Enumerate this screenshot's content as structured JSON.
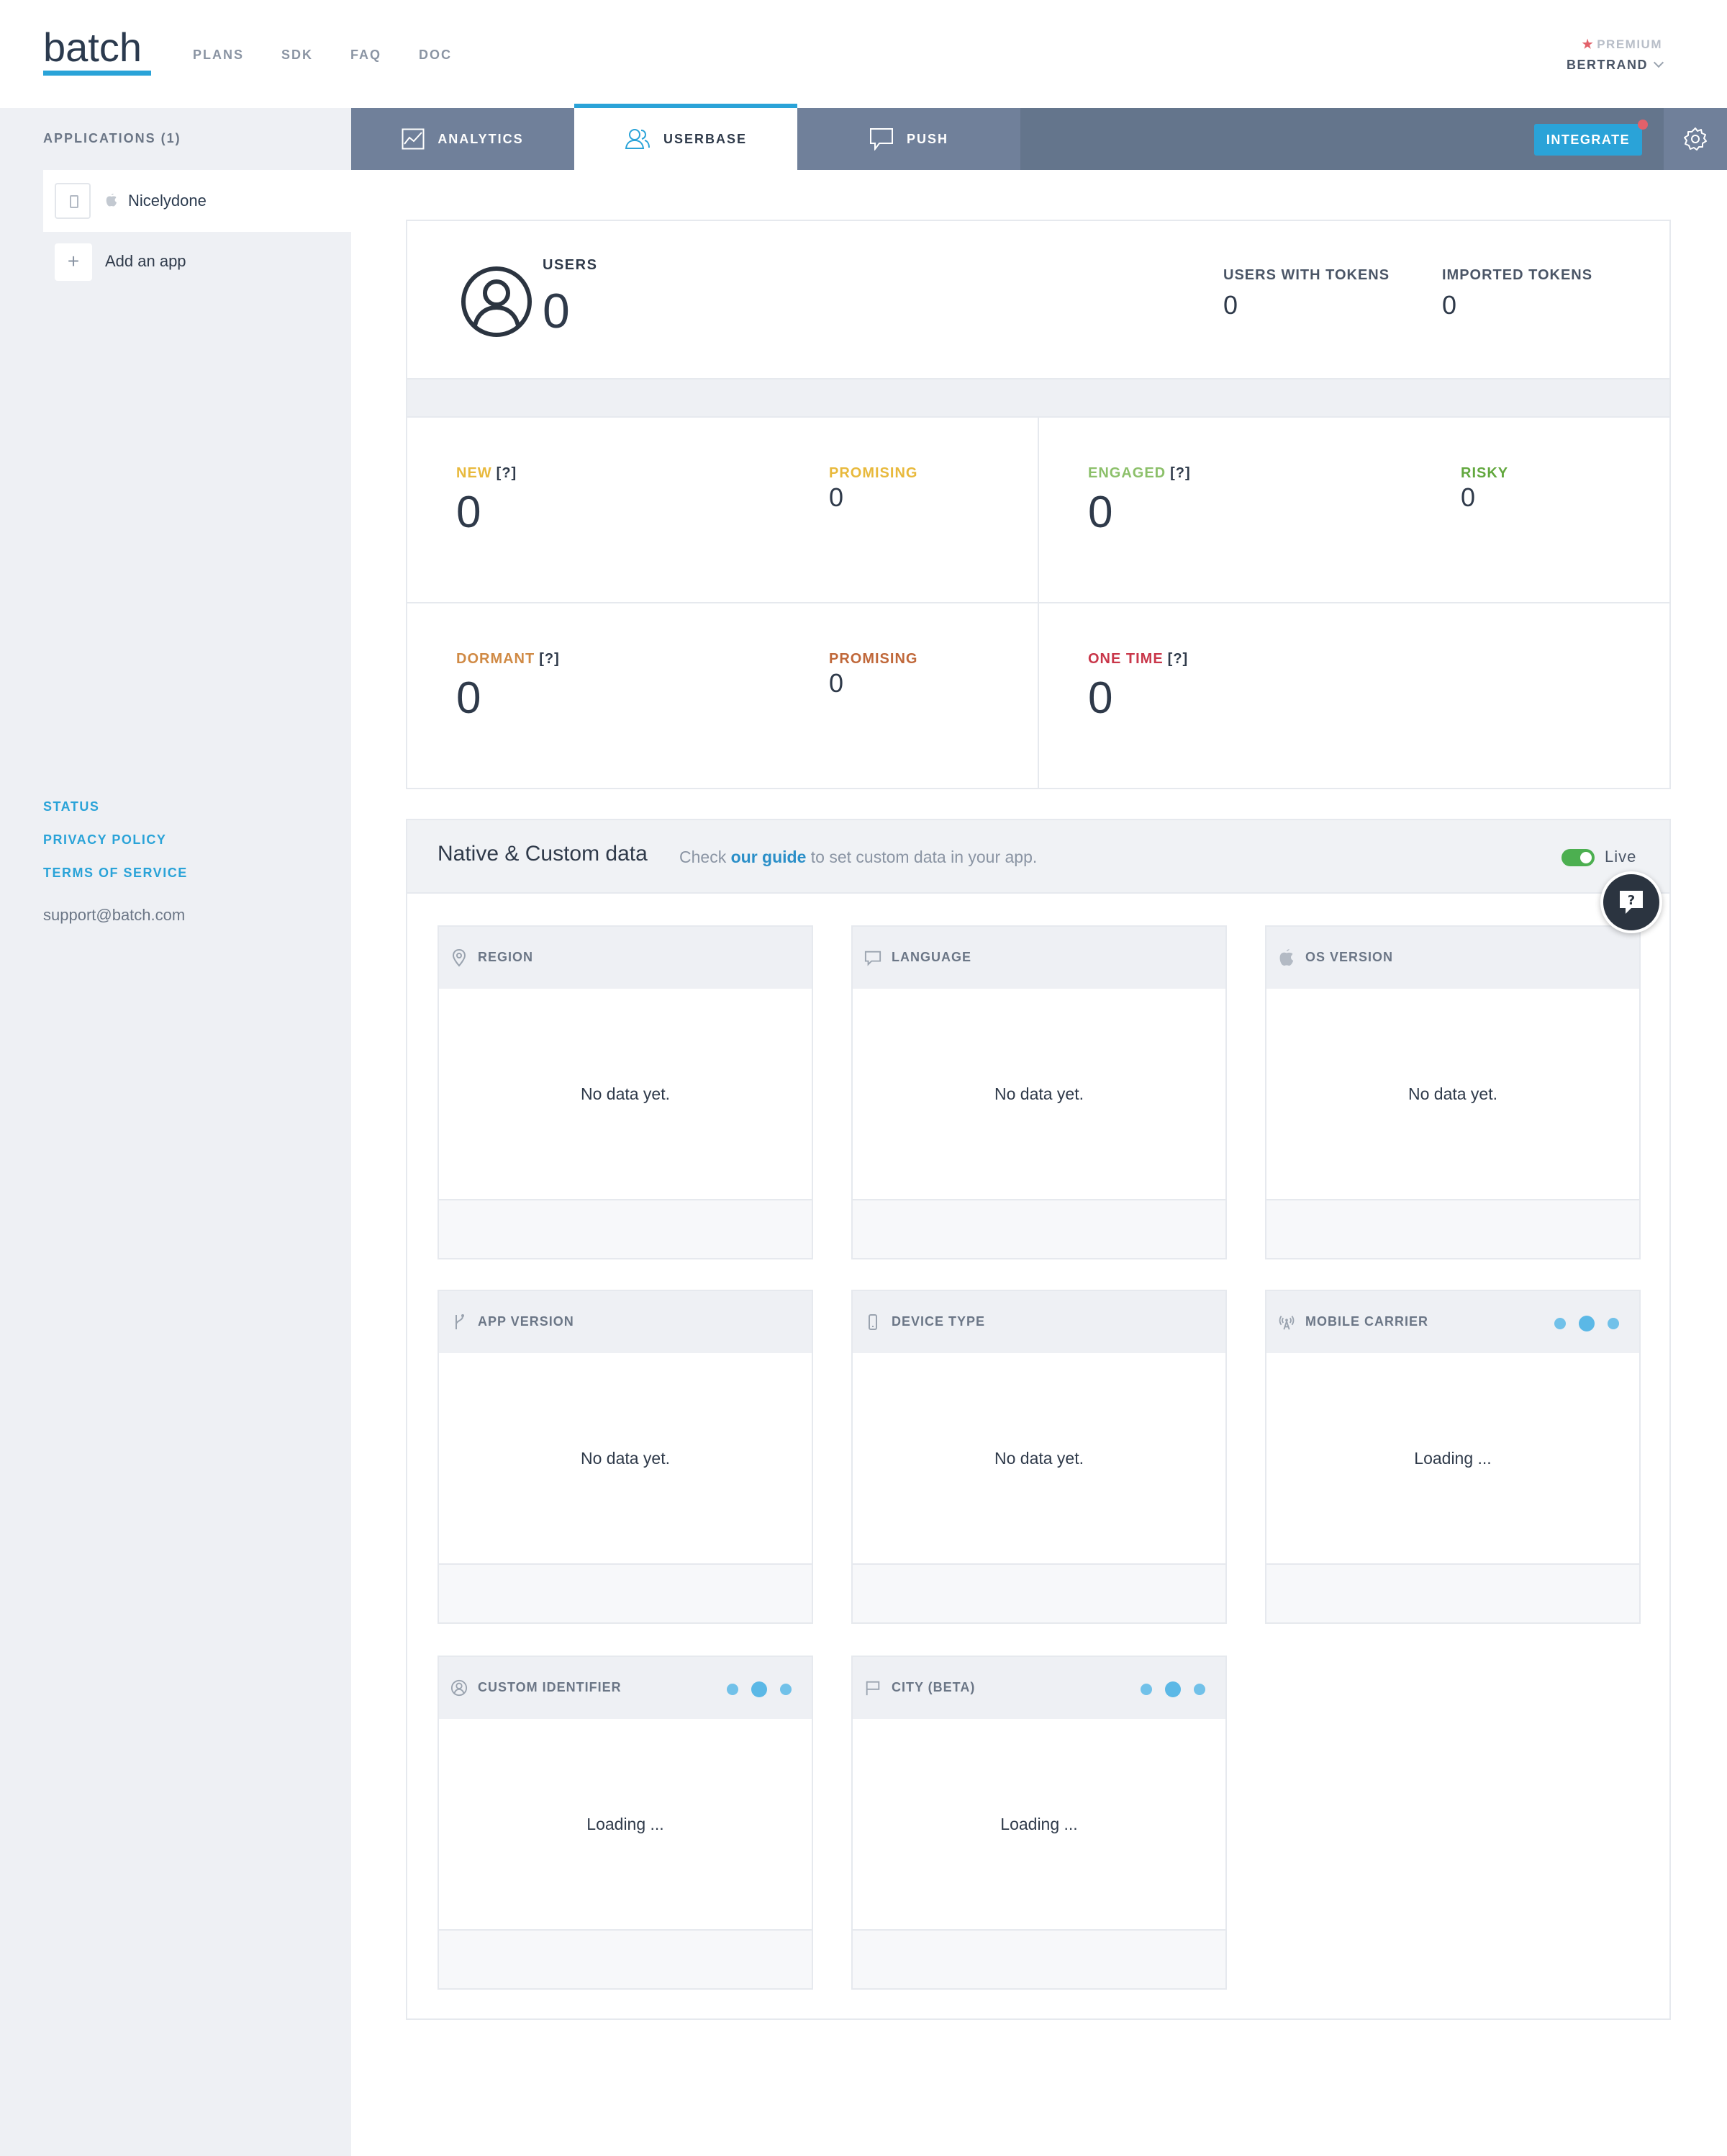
{
  "header": {
    "logo": "batch",
    "nav": [
      "PLANS",
      "SDK",
      "FAQ",
      "DOC"
    ],
    "plan": "PREMIUM",
    "user": "BERTRAND"
  },
  "sidebar": {
    "apps_title": "APPLICATIONS (1)",
    "app_name": "Nicelydone",
    "add_app": "Add an app",
    "links": [
      "STATUS",
      "PRIVACY POLICY",
      "TERMS OF SERVICE"
    ],
    "support": "support@batch.com"
  },
  "tabs": {
    "items": [
      "ANALYTICS",
      "USERBASE",
      "PUSH"
    ],
    "active": "USERBASE",
    "integrate": "INTEGRATE"
  },
  "users": {
    "label": "USERS",
    "value": "0",
    "tokens_label": "USERS WITH TOKENS",
    "tokens_value": "0",
    "imported_label": "IMPORTED TOKENS",
    "imported_value": "0"
  },
  "segments": {
    "help": "[?]",
    "new": {
      "label": "NEW",
      "value": "0",
      "sub_label": "PROMISING",
      "sub_value": "0"
    },
    "engaged": {
      "label": "ENGAGED",
      "value": "0",
      "sub_label": "RISKY",
      "sub_value": "0"
    },
    "dormant": {
      "label": "DORMANT",
      "value": "0",
      "sub_label": "PROMISING",
      "sub_value": "0"
    },
    "one_time": {
      "label": "ONE TIME",
      "value": "0"
    }
  },
  "colors": {
    "accent": "#2aa3d8",
    "new": "#e8b93c",
    "promising_new": "#e8b93c",
    "engaged": "#8cc06a",
    "risky": "#62a83e",
    "dormant": "#d08a45",
    "promising_dormant": "#c0683a",
    "one_time": "#c9374a"
  },
  "native": {
    "title": "Native & Custom data",
    "sub_prefix": "Check",
    "sub_link": "our guide",
    "sub_suffix": "to set custom data in your app.",
    "live": "Live",
    "panels": [
      {
        "title": "REGION",
        "icon": "pin-icon",
        "body": "No data yet."
      },
      {
        "title": "LANGUAGE",
        "icon": "speech-bubble-icon",
        "body": "No data yet."
      },
      {
        "title": "OS VERSION",
        "icon": "apple-icon",
        "body": "No data yet."
      },
      {
        "title": "APP VERSION",
        "icon": "branch-icon",
        "body": "No data yet."
      },
      {
        "title": "DEVICE TYPE",
        "icon": "phone-icon",
        "body": "No data yet."
      },
      {
        "title": "MOBILE CARRIER",
        "icon": "antenna-icon",
        "body": "Loading ..."
      },
      {
        "title": "CUSTOM IDENTIFIER",
        "icon": "person-icon",
        "body": "Loading ..."
      },
      {
        "title": "CITY (BETA)",
        "icon": "flag-icon",
        "body": "Loading ..."
      }
    ]
  }
}
